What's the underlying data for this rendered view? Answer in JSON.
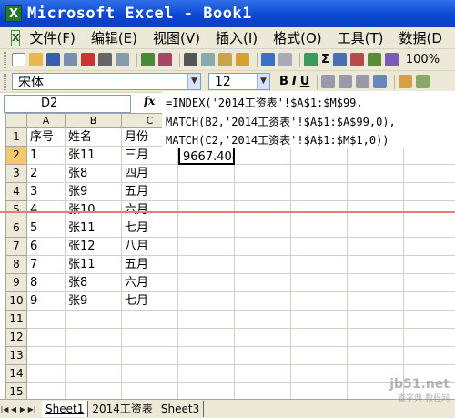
{
  "window": {
    "title": "Microsoft Excel - Book1",
    "app_icon": "X"
  },
  "menu": {
    "items": [
      "文件(F)",
      "编辑(E)",
      "视图(V)",
      "插入(I)",
      "格式(O)",
      "工具(T)",
      "数据(D"
    ]
  },
  "toolbar": {
    "buttons": [
      "new-icon",
      "open-icon",
      "save-icon",
      "permission-icon",
      "email-icon",
      "print-icon",
      "preview-icon",
      "spell-icon",
      "research-icon",
      "cut-icon",
      "copy-icon",
      "paste-icon",
      "format-painter-icon",
      "undo-icon",
      "redo-icon",
      "hyperlink-icon",
      "sum-icon",
      "sort-asc-icon",
      "sort-desc-icon",
      "chart-icon",
      "drawing-icon"
    ],
    "sum_label": "Σ",
    "zoom": "100%"
  },
  "format_toolbar": {
    "font": "宋体",
    "size": "12",
    "bold": "B",
    "italic": "I",
    "underline": "U"
  },
  "formula_bar": {
    "name_box": "D2",
    "fx": "fx",
    "formula_lines": [
      "=INDEX('2014工资表'!$A$1:$M$99,",
      "MATCH(B2,'2014工资表'!$A$1:$A$99,0),",
      "MATCH(C2,'2014工资表'!$A$1:$M$1,0))"
    ]
  },
  "sheet": {
    "columns": [
      "A",
      "B",
      "C"
    ],
    "rows": [
      "1",
      "2",
      "3",
      "4",
      "5",
      "6",
      "7",
      "8",
      "9",
      "10",
      "11",
      "12",
      "13",
      "14",
      "15"
    ],
    "cells": [
      [
        "序号",
        "姓名",
        "月份",
        ""
      ],
      [
        "1",
        "张11",
        "三月",
        "9667.408"
      ],
      [
        "2",
        "张8",
        "四月",
        ""
      ],
      [
        "3",
        "张9",
        "五月",
        ""
      ],
      [
        "4",
        "张10",
        "六月",
        ""
      ],
      [
        "5",
        "张11",
        "七月",
        ""
      ],
      [
        "6",
        "张12",
        "八月",
        ""
      ],
      [
        "7",
        "张11",
        "五月",
        ""
      ],
      [
        "8",
        "张8",
        "六月",
        ""
      ],
      [
        "9",
        "张9",
        "七月",
        ""
      ]
    ],
    "selected_cell": "D2"
  },
  "tabs": [
    "Sheet1",
    "2014工资表",
    "Sheet3"
  ],
  "active_tab": "Sheet1",
  "watermark": {
    "line1": "jb51.net",
    "line2": "查字典 教程网"
  }
}
